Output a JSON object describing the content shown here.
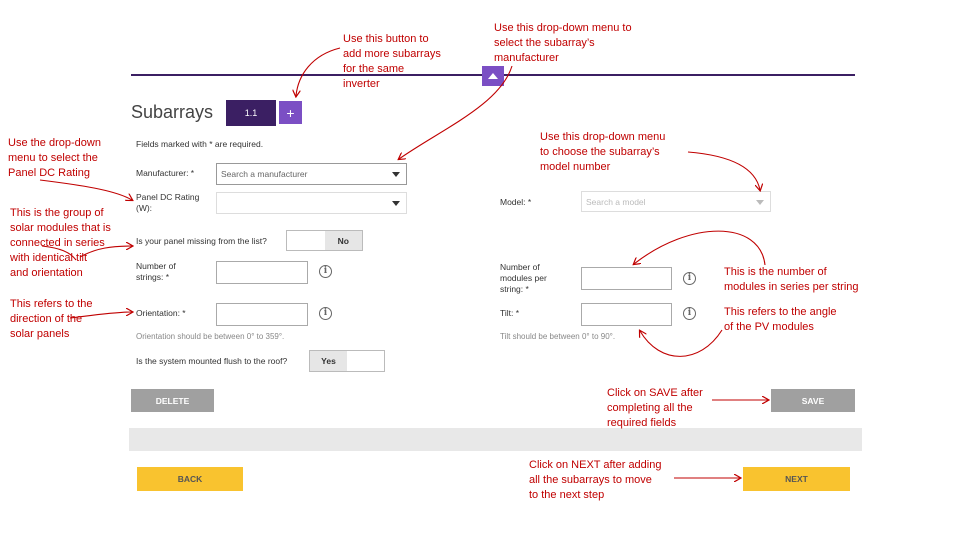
{
  "header": {
    "title": "Subarrays",
    "tab_label": "1.1",
    "add_icon": "+",
    "collapse_icon": "^"
  },
  "form": {
    "required_note": "Fields marked with * are required.",
    "manufacturer": {
      "label": "Manufacturer: *",
      "placeholder": "Search a manufacturer"
    },
    "panel_rating": {
      "label_line1": "Panel DC Rating",
      "label_line2": "(W):"
    },
    "missing": {
      "question": "Is your panel missing from the list?",
      "toggle_value": "No"
    },
    "strings": {
      "label_line1": "Number of",
      "label_line2": "strings: *"
    },
    "orientation": {
      "label": "Orientation: *",
      "hint": "Orientation should be between 0° to 359°."
    },
    "flush": {
      "question": "Is the system mounted flush to the roof?",
      "toggle_value": "Yes"
    },
    "model": {
      "label": "Model: *",
      "placeholder": "Search a model"
    },
    "modules": {
      "label_line1": "Number of",
      "label_line2": "modules per",
      "label_line3": "string: *"
    },
    "tilt": {
      "label": "Tilt: *",
      "hint": "Tilt should be between 0° to 90°."
    },
    "info_icon": "i"
  },
  "buttons": {
    "delete": "DELETE",
    "save": "SAVE",
    "back": "BACK",
    "next": "NEXT"
  },
  "annotations": {
    "add_button": [
      "Use this button to",
      "add more subarrays",
      "for the same",
      "inverter"
    ],
    "manufacturer": [
      "Use this drop-down menu to",
      "select the subarray’s",
      "manufacturer"
    ],
    "model": [
      "Use this drop-down menu",
      "to choose the subarray’s",
      "model number"
    ],
    "panel_rating": [
      "Use the drop-down",
      "menu to select the",
      "Panel DC Rating"
    ],
    "strings": [
      "This is the group of",
      "solar modules that is",
      "connected in series",
      "with identical tilt",
      "and orientation"
    ],
    "orientation": [
      "This refers to the",
      "direction of the",
      "solar panels"
    ],
    "modules": [
      "This is the number of",
      "modules in series per string"
    ],
    "tilt": [
      "This refers to the angle",
      "of the PV modules"
    ],
    "save": [
      "Click on SAVE after",
      "completing all the",
      "required fields"
    ],
    "next": [
      "Click on NEXT after adding",
      "all the subarrays to move",
      "to the next step"
    ]
  },
  "colors": {
    "accent_dark": "#3b1f63",
    "accent_purple": "#7b4fc4",
    "gray_button": "#a0a0a0",
    "yellow_button": "#f9c32f",
    "annotation": "#c00000"
  }
}
